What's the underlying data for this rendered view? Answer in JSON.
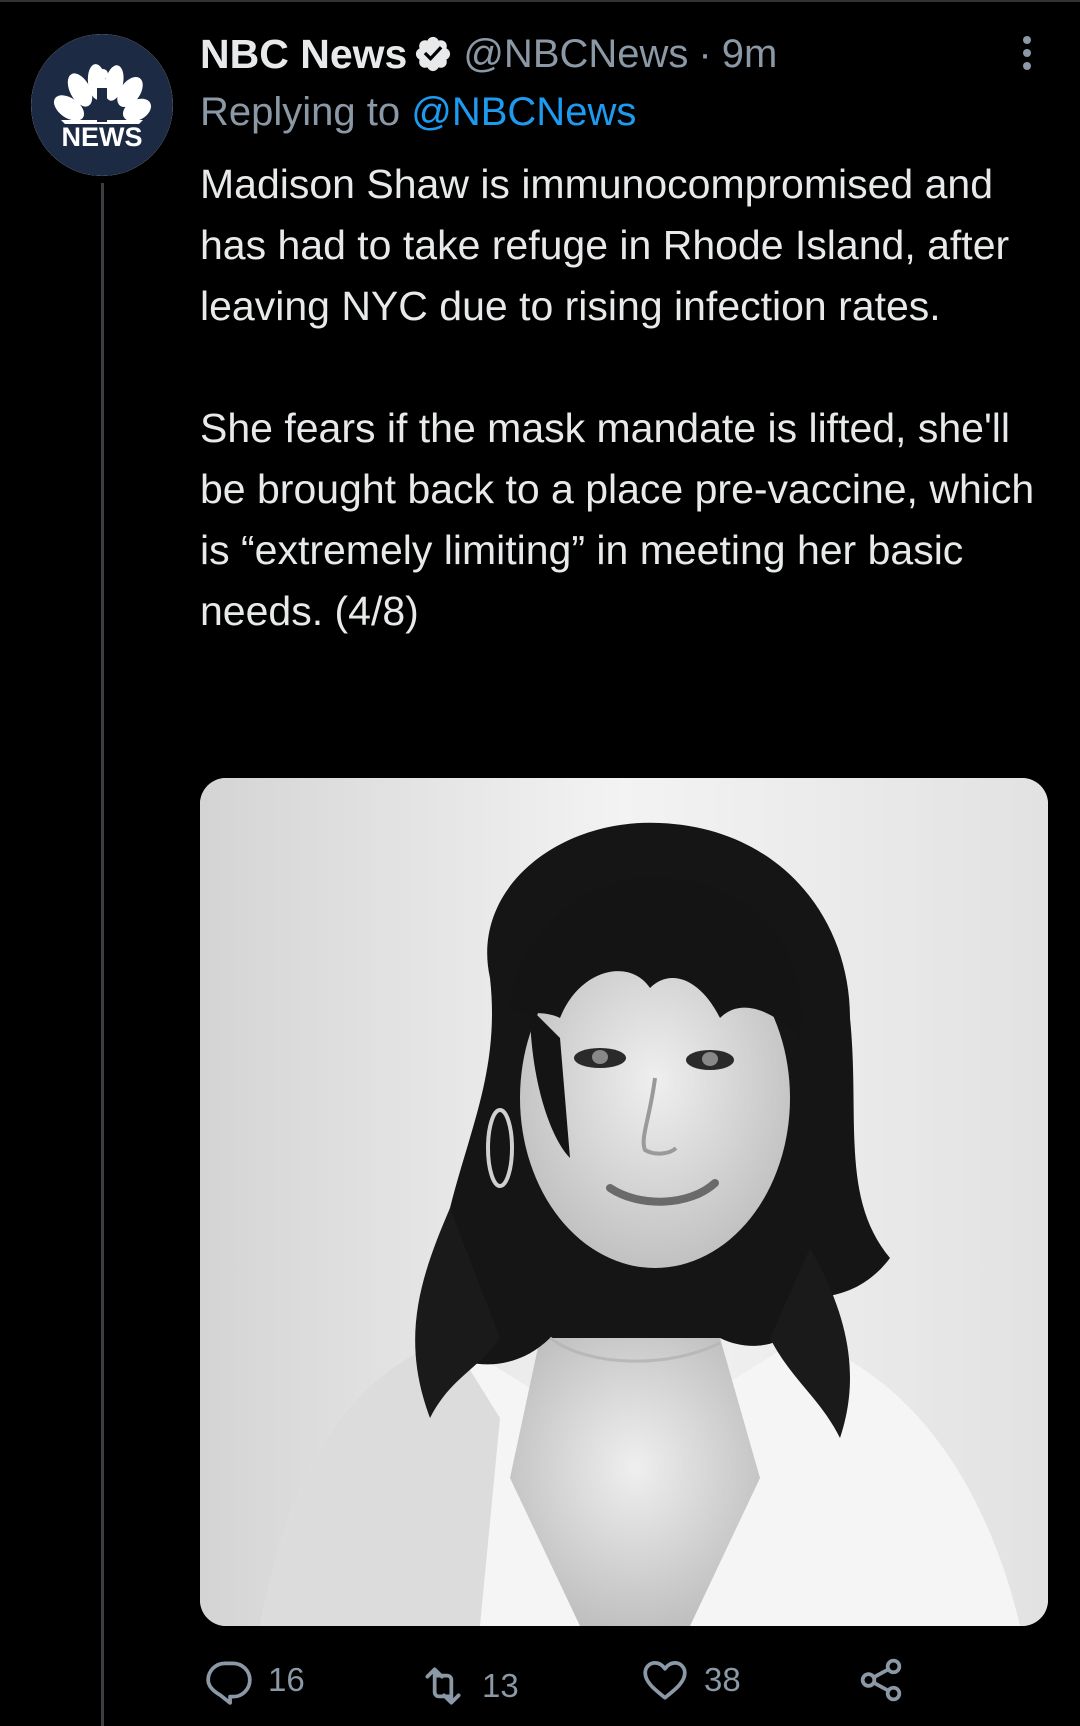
{
  "tweet": {
    "display_name": "NBC News",
    "handle": "@NBCNews",
    "separator": "·",
    "time": "9m",
    "replying_to_label": "Replying to",
    "replying_to_handle": "@NBCNews",
    "avatar_logo_text": "NEWS",
    "paragraph_1": "Madison Shaw is immunocompromised and has had to take refuge in Rhode Island, after leaving NYC due to rising infection rates.",
    "paragraph_2": "She fears if the mask mandate is lifted, she'll be brought back to a place pre-vaccine, which is “extremely limiting” in meeting her basic needs. (4/8)"
  },
  "actions": {
    "reply_count": "16",
    "retweet_count": "13",
    "like_count": "38"
  },
  "icons": {
    "verified": "verified-badge-icon",
    "more": "more-options-icon",
    "reply": "reply-icon",
    "retweet": "retweet-icon",
    "like": "heart-icon",
    "share": "share-icon"
  },
  "colors": {
    "background": "#000000",
    "text_primary": "#e7e9ea",
    "text_secondary": "#8b98a5",
    "link": "#1d9bf0",
    "avatar_bg": "#1c2a44"
  }
}
